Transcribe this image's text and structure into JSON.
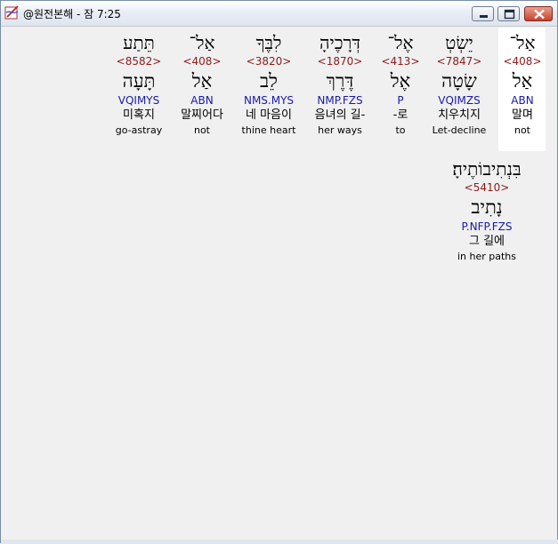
{
  "window": {
    "title": "@원전본해 - 잠 7:25",
    "controls": {
      "minimize": "minimize",
      "maximize": "maximize",
      "close": "close"
    }
  },
  "verse": {
    "words": [
      {
        "hebrew": "אַל־",
        "strong": "<408>",
        "lemma": "אַל",
        "morph": "ABN",
        "korean": "말며",
        "english": "not",
        "highlight": true
      },
      {
        "hebrew": "יֵשְׂטְ",
        "strong": "<7847>",
        "lemma": "שָׂטָה",
        "morph": "VQIMZS",
        "korean": "치우치지",
        "english": "Let-decline",
        "highlight": false
      },
      {
        "hebrew": "אֶל־",
        "strong": "<413>",
        "lemma": "אֶל",
        "morph": "P",
        "korean": "-로",
        "english": "to",
        "highlight": false
      },
      {
        "hebrew": "דְּרָכֶיהָ",
        "strong": "<1870>",
        "lemma": "דֶּרֶךְ",
        "morph": "NMP.FZS",
        "korean": "음녀의 길-",
        "english": "her ways",
        "highlight": false
      },
      {
        "hebrew": "לִבֶּךָ",
        "strong": "<3820>",
        "lemma": "לֵב",
        "morph": "NMS.MYS",
        "korean": "네 마음이",
        "english": "thine heart",
        "highlight": false
      },
      {
        "hebrew": "אַל־",
        "strong": "<408>",
        "lemma": "אַל",
        "morph": "ABN",
        "korean": "말찌어다",
        "english": "not",
        "highlight": false
      },
      {
        "hebrew": "תֵּתַע",
        "strong": "<8582>",
        "lemma": "תָּעָה",
        "morph": "VQIMYS",
        "korean": "미혹지",
        "english": "go-astray",
        "highlight": false
      },
      {
        "hebrew": "בִּנְתִיבוֹתֶיהָ׃",
        "strong": "<5410>",
        "lemma": "נָתִיב",
        "morph": "P.NFP.FZS",
        "korean": "그 길에",
        "english": "in her paths",
        "highlight": false
      }
    ]
  }
}
